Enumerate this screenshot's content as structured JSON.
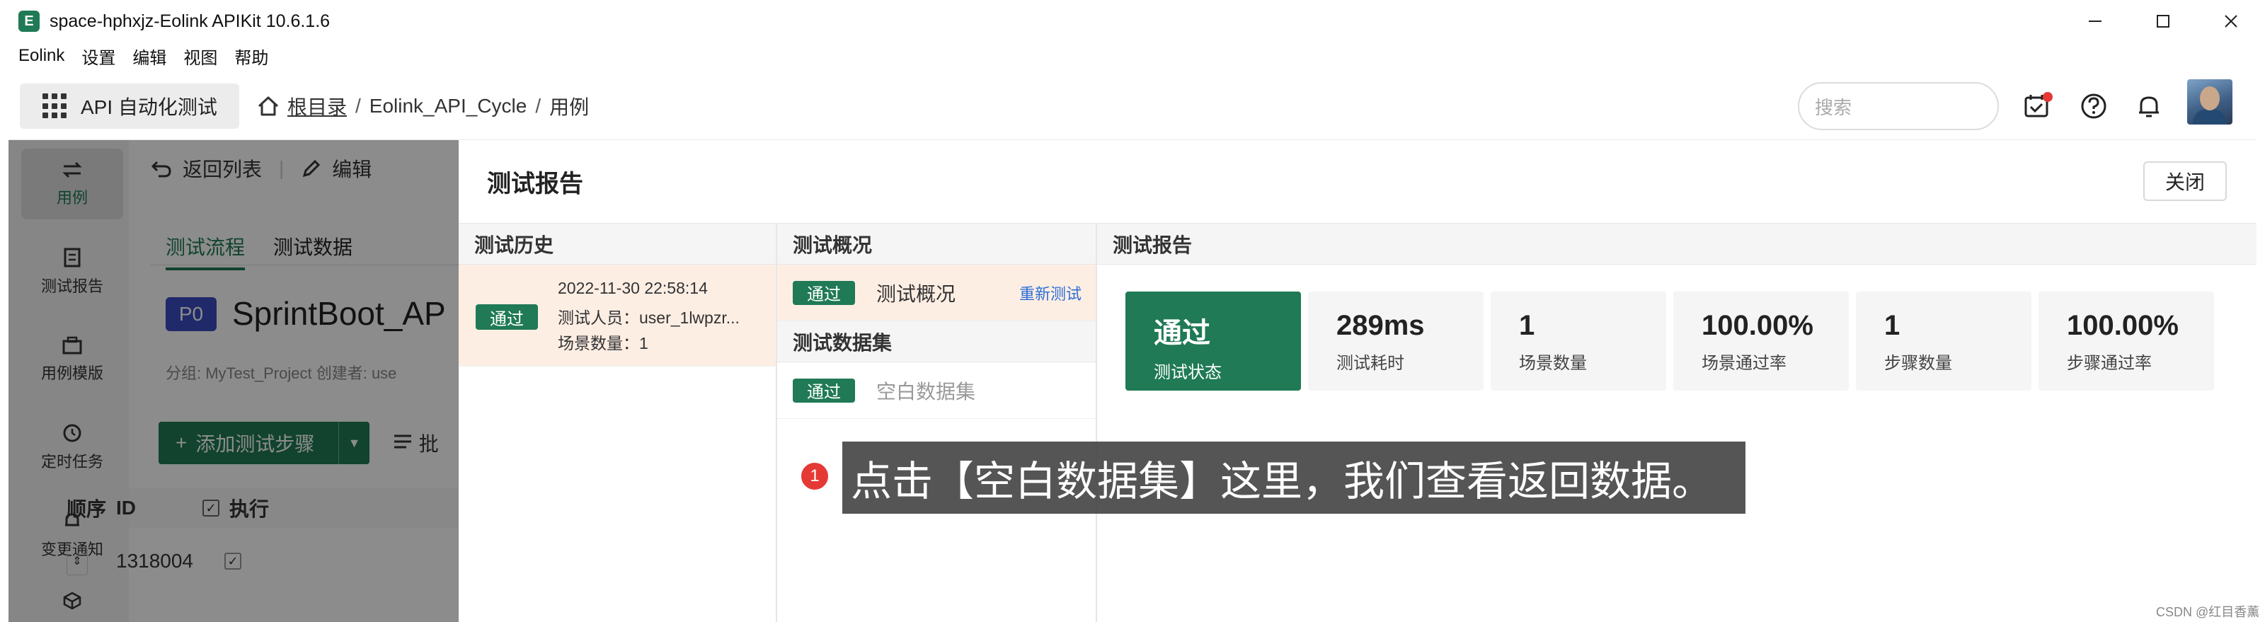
{
  "window": {
    "title": "space-hphxjz-Eolink APIKit 10.6.1.6",
    "app_icon_letter": "E"
  },
  "menu": [
    "Eolink",
    "设置",
    "编辑",
    "视图",
    "帮助"
  ],
  "topbar": {
    "module_label": "API 自动化测试",
    "breadcrumb": [
      "根目录",
      "Eolink_API_Cycle",
      "用例"
    ],
    "search_placeholder": "搜索"
  },
  "sidebar": [
    "用例",
    "测试报告",
    "用例模版",
    "定时任务",
    "变更通知"
  ],
  "background": {
    "back_label": "返回列表",
    "edit_label": "编辑",
    "tabs": [
      "测试流程",
      "测试数据"
    ],
    "priority": "P0",
    "case_title": "SprintBoot_AP",
    "meta": "分组: MyTest_Project     创建者: use",
    "add_step_label": "添加测试步骤",
    "batch_label": "批",
    "table_headers": [
      "顺序",
      "ID",
      "执行"
    ],
    "row": {
      "id": "1318004"
    }
  },
  "report": {
    "title": "测试报告",
    "close_label": "关闭",
    "history_header": "测试历史",
    "history": {
      "status": "通过",
      "time": "2022-11-30 22:58:14",
      "tester": "测试人员：user_1lwpzr...",
      "scenes": "场景数量：1"
    },
    "overview_header": "测试概况",
    "overview_item": {
      "status": "通过",
      "name": "测试概况",
      "retest": "重新测试"
    },
    "dataset_header": "测试数据集",
    "dataset_item": {
      "status": "通过",
      "name": "空白数据集"
    },
    "report_header": "测试报告",
    "stats": [
      {
        "value": "通过",
        "label": "测试状态"
      },
      {
        "value": "289ms",
        "label": "测试耗时"
      },
      {
        "value": "1",
        "label": "场景数量"
      },
      {
        "value": "100.00%",
        "label": "场景通过率"
      },
      {
        "value": "1",
        "label": "步骤数量"
      },
      {
        "value": "100.00%",
        "label": "步骤通过率"
      }
    ]
  },
  "annotation": {
    "number": "1",
    "text": "点击【空白数据集】这里，我们查看返回数据。"
  },
  "watermark": "CSDN @红目香薰",
  "colors": {
    "accent": "#1f7a55",
    "selected_bg": "#fdeee4",
    "link": "#2d6fd6"
  }
}
